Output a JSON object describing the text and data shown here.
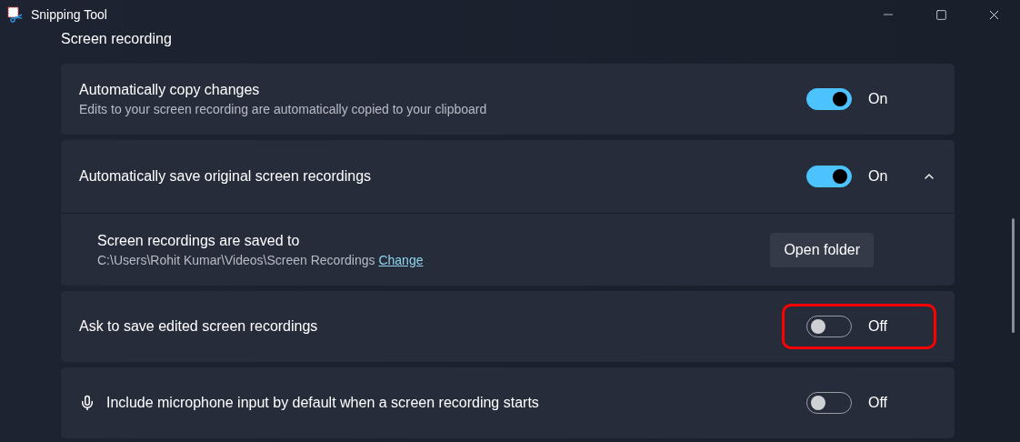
{
  "window": {
    "title": "Snipping Tool"
  },
  "section": {
    "title": "Screen recording"
  },
  "settings": [
    {
      "kind": "toggle",
      "title": "Automatically copy changes",
      "description": "Edits to your screen recording are automatically copied to your clipboard",
      "on": true,
      "state_label": "On",
      "highlighted": false
    },
    {
      "kind": "expander",
      "title": "Automatically save original screen recordings",
      "on": true,
      "state_label": "On",
      "highlighted": false,
      "expanded": true,
      "detail": {
        "title": "Screen recordings are saved to",
        "path": "C:\\Users\\Rohit Kumar\\Videos\\Screen Recordings",
        "link": "Change",
        "button": "Open folder"
      }
    },
    {
      "kind": "toggle",
      "title": "Ask to save edited screen recordings",
      "on": false,
      "state_label": "Off",
      "highlighted": true
    },
    {
      "kind": "icon-toggle",
      "title": "Include microphone input by default when a screen recording starts",
      "on": false,
      "state_label": "Off",
      "highlighted": false
    }
  ]
}
